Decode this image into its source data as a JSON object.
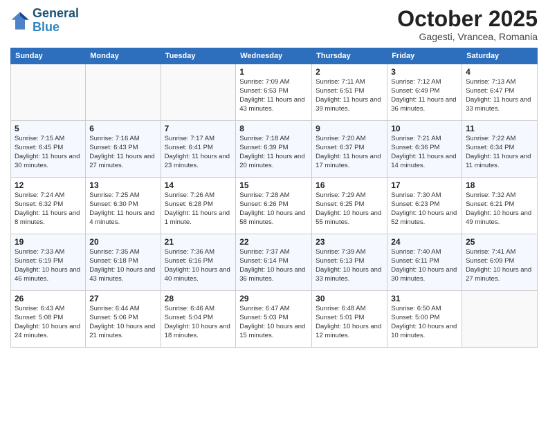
{
  "logo": {
    "line1": "General",
    "line2": "Blue"
  },
  "title": "October 2025",
  "subtitle": "Gagesti, Vrancea, Romania",
  "weekdays": [
    "Sunday",
    "Monday",
    "Tuesday",
    "Wednesday",
    "Thursday",
    "Friday",
    "Saturday"
  ],
  "weeks": [
    [
      {
        "day": "",
        "info": ""
      },
      {
        "day": "",
        "info": ""
      },
      {
        "day": "",
        "info": ""
      },
      {
        "day": "1",
        "info": "Sunrise: 7:09 AM\nSunset: 6:53 PM\nDaylight: 11 hours\nand 43 minutes."
      },
      {
        "day": "2",
        "info": "Sunrise: 7:11 AM\nSunset: 6:51 PM\nDaylight: 11 hours\nand 39 minutes."
      },
      {
        "day": "3",
        "info": "Sunrise: 7:12 AM\nSunset: 6:49 PM\nDaylight: 11 hours\nand 36 minutes."
      },
      {
        "day": "4",
        "info": "Sunrise: 7:13 AM\nSunset: 6:47 PM\nDaylight: 11 hours\nand 33 minutes."
      }
    ],
    [
      {
        "day": "5",
        "info": "Sunrise: 7:15 AM\nSunset: 6:45 PM\nDaylight: 11 hours\nand 30 minutes."
      },
      {
        "day": "6",
        "info": "Sunrise: 7:16 AM\nSunset: 6:43 PM\nDaylight: 11 hours\nand 27 minutes."
      },
      {
        "day": "7",
        "info": "Sunrise: 7:17 AM\nSunset: 6:41 PM\nDaylight: 11 hours\nand 23 minutes."
      },
      {
        "day": "8",
        "info": "Sunrise: 7:18 AM\nSunset: 6:39 PM\nDaylight: 11 hours\nand 20 minutes."
      },
      {
        "day": "9",
        "info": "Sunrise: 7:20 AM\nSunset: 6:37 PM\nDaylight: 11 hours\nand 17 minutes."
      },
      {
        "day": "10",
        "info": "Sunrise: 7:21 AM\nSunset: 6:36 PM\nDaylight: 11 hours\nand 14 minutes."
      },
      {
        "day": "11",
        "info": "Sunrise: 7:22 AM\nSunset: 6:34 PM\nDaylight: 11 hours\nand 11 minutes."
      }
    ],
    [
      {
        "day": "12",
        "info": "Sunrise: 7:24 AM\nSunset: 6:32 PM\nDaylight: 11 hours\nand 8 minutes."
      },
      {
        "day": "13",
        "info": "Sunrise: 7:25 AM\nSunset: 6:30 PM\nDaylight: 11 hours\nand 4 minutes."
      },
      {
        "day": "14",
        "info": "Sunrise: 7:26 AM\nSunset: 6:28 PM\nDaylight: 11 hours\nand 1 minute."
      },
      {
        "day": "15",
        "info": "Sunrise: 7:28 AM\nSunset: 6:26 PM\nDaylight: 10 hours\nand 58 minutes."
      },
      {
        "day": "16",
        "info": "Sunrise: 7:29 AM\nSunset: 6:25 PM\nDaylight: 10 hours\nand 55 minutes."
      },
      {
        "day": "17",
        "info": "Sunrise: 7:30 AM\nSunset: 6:23 PM\nDaylight: 10 hours\nand 52 minutes."
      },
      {
        "day": "18",
        "info": "Sunrise: 7:32 AM\nSunset: 6:21 PM\nDaylight: 10 hours\nand 49 minutes."
      }
    ],
    [
      {
        "day": "19",
        "info": "Sunrise: 7:33 AM\nSunset: 6:19 PM\nDaylight: 10 hours\nand 46 minutes."
      },
      {
        "day": "20",
        "info": "Sunrise: 7:35 AM\nSunset: 6:18 PM\nDaylight: 10 hours\nand 43 minutes."
      },
      {
        "day": "21",
        "info": "Sunrise: 7:36 AM\nSunset: 6:16 PM\nDaylight: 10 hours\nand 40 minutes."
      },
      {
        "day": "22",
        "info": "Sunrise: 7:37 AM\nSunset: 6:14 PM\nDaylight: 10 hours\nand 36 minutes."
      },
      {
        "day": "23",
        "info": "Sunrise: 7:39 AM\nSunset: 6:13 PM\nDaylight: 10 hours\nand 33 minutes."
      },
      {
        "day": "24",
        "info": "Sunrise: 7:40 AM\nSunset: 6:11 PM\nDaylight: 10 hours\nand 30 minutes."
      },
      {
        "day": "25",
        "info": "Sunrise: 7:41 AM\nSunset: 6:09 PM\nDaylight: 10 hours\nand 27 minutes."
      }
    ],
    [
      {
        "day": "26",
        "info": "Sunrise: 6:43 AM\nSunset: 5:08 PM\nDaylight: 10 hours\nand 24 minutes."
      },
      {
        "day": "27",
        "info": "Sunrise: 6:44 AM\nSunset: 5:06 PM\nDaylight: 10 hours\nand 21 minutes."
      },
      {
        "day": "28",
        "info": "Sunrise: 6:46 AM\nSunset: 5:04 PM\nDaylight: 10 hours\nand 18 minutes."
      },
      {
        "day": "29",
        "info": "Sunrise: 6:47 AM\nSunset: 5:03 PM\nDaylight: 10 hours\nand 15 minutes."
      },
      {
        "day": "30",
        "info": "Sunrise: 6:48 AM\nSunset: 5:01 PM\nDaylight: 10 hours\nand 12 minutes."
      },
      {
        "day": "31",
        "info": "Sunrise: 6:50 AM\nSunset: 5:00 PM\nDaylight: 10 hours\nand 10 minutes."
      },
      {
        "day": "",
        "info": ""
      }
    ]
  ]
}
